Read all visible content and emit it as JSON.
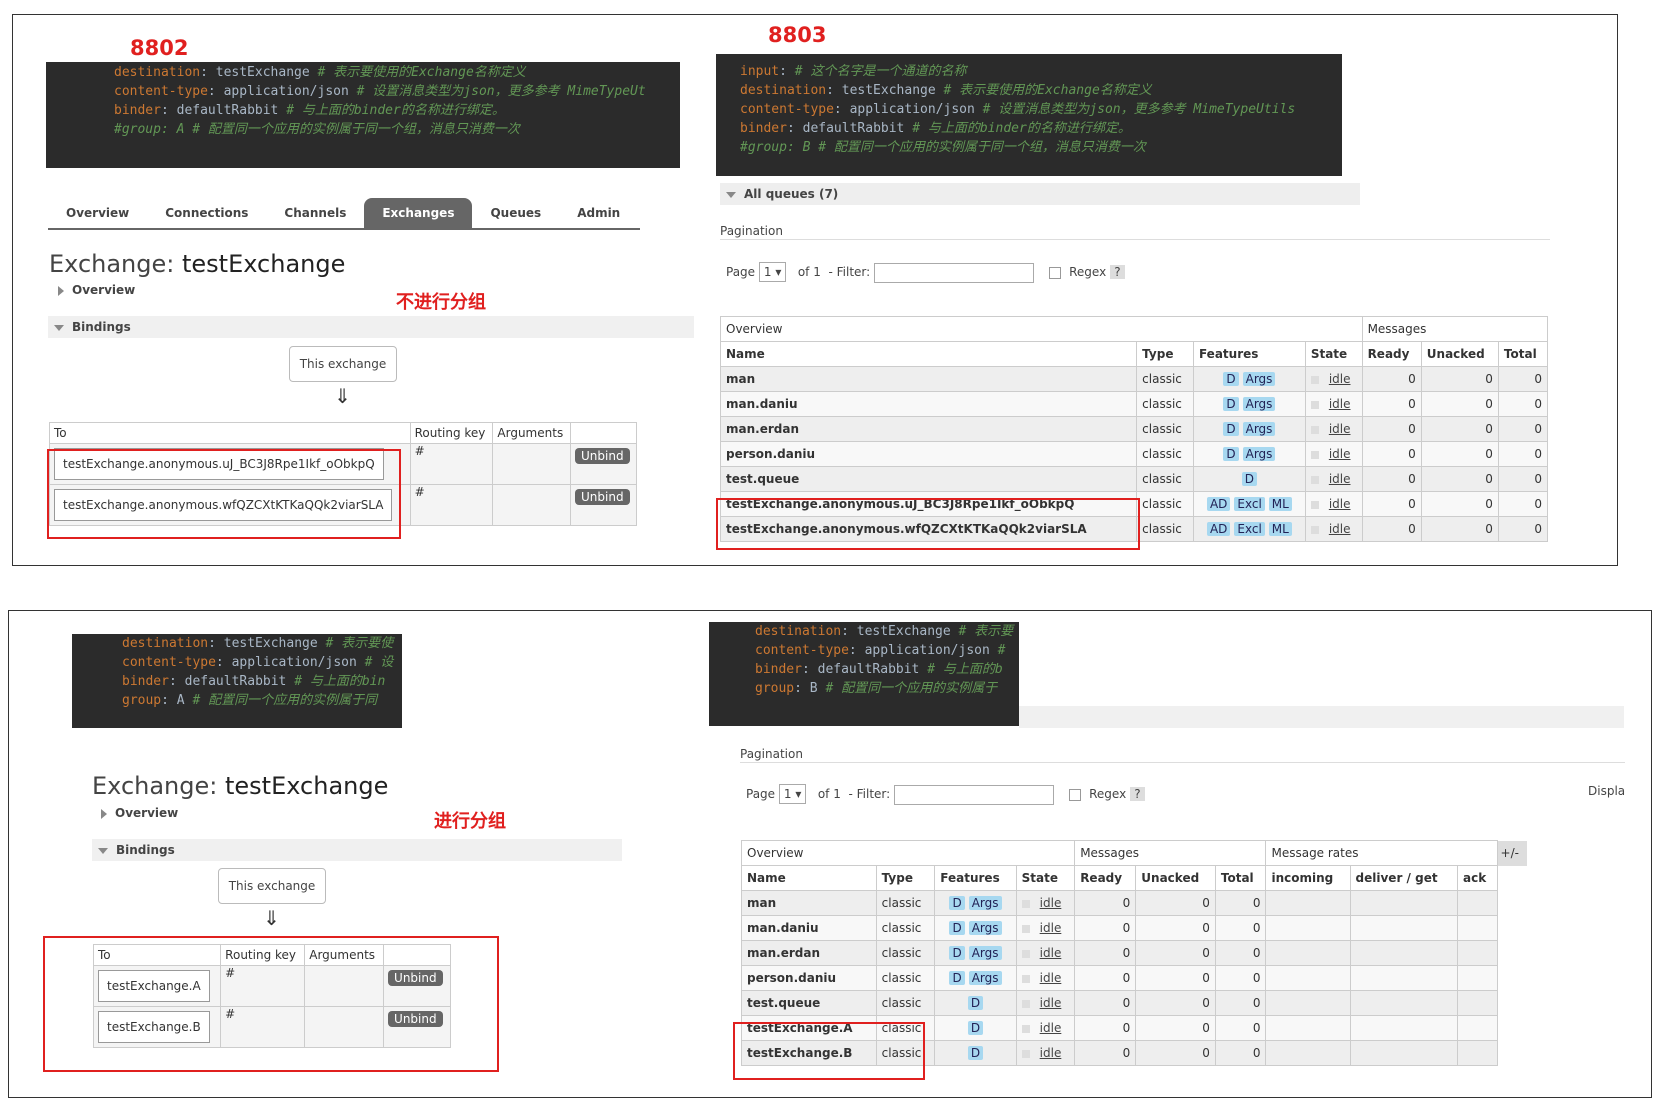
{
  "top": {
    "left_label": "8802",
    "right_label": "8803",
    "left_code": [
      {
        "key": "destination",
        "value": "testExchange",
        "comment": "# 表示要使用的Exchange名称定义"
      },
      {
        "key": "content-type",
        "value": "application/json",
        "comment": "# 设置消息类型为json，更多参考 MimeTypeUt"
      },
      {
        "key": "binder",
        "value": "defaultRabbit",
        "comment": "# 与上面的binder的名称进行绑定。"
      },
      {
        "key": "",
        "value": "",
        "comment": "#group: A # 配置同一个应用的实例属于同一个组，消息只消费一次"
      }
    ],
    "right_code": [
      {
        "key": "input",
        "value": "",
        "comment": "# 这个名字是一个通道的名称"
      },
      {
        "key": "destination",
        "value": "testExchange",
        "comment": "# 表示要使用的Exchange名称定义"
      },
      {
        "key": "content-type",
        "value": "application/json",
        "comment": "# 设置消息类型为json，更多参考 MimeTypeUtils"
      },
      {
        "key": "binder",
        "value": "defaultRabbit",
        "comment": "# 与上面的binder的名称进行绑定。"
      },
      {
        "key": "",
        "value": "",
        "comment": "#group: B # 配置同一个应用的实例属于同一个组，消息只消费一次"
      }
    ],
    "tabs": [
      "Overview",
      "Connections",
      "Channels",
      "Exchanges",
      "Queues",
      "Admin"
    ],
    "exchange_prefix": "Exchange:",
    "exchange_name": "testExchange",
    "overview_label": "Overview",
    "bindings_label": "Bindings",
    "annotation": "不进行分组",
    "this_exchange": "This exchange",
    "arrow": "⇓",
    "bind_headers": [
      "To",
      "Routing key",
      "Arguments"
    ],
    "bindings": [
      {
        "to": "testExchange.anonymous.uJ_BC3J8Rpe1Ikf_oObkpQ",
        "key": "#",
        "unbind": "Unbind"
      },
      {
        "to": "testExchange.anonymous.wfQZCXtKTKaQQk2viarSLA",
        "key": "#",
        "unbind": "Unbind"
      }
    ],
    "all_queues": "All queues (7)",
    "pagination": "Pagination",
    "page_label": "Page",
    "page_value": "1",
    "of_label": "of 1",
    "filter_label": "- Filter:",
    "regex_label": "Regex",
    "help": "?",
    "groups": {
      "overview": "Overview",
      "messages": "Messages"
    },
    "cols": [
      "Name",
      "Type",
      "Features",
      "State",
      "Ready",
      "Unacked",
      "Total"
    ],
    "queues": [
      {
        "name": "man",
        "type": "classic",
        "features": [
          "D",
          "Args"
        ],
        "state": "idle",
        "ready": "0",
        "unacked": "0",
        "total": "0"
      },
      {
        "name": "man.daniu",
        "type": "classic",
        "features": [
          "D",
          "Args"
        ],
        "state": "idle",
        "ready": "0",
        "unacked": "0",
        "total": "0"
      },
      {
        "name": "man.erdan",
        "type": "classic",
        "features": [
          "D",
          "Args"
        ],
        "state": "idle",
        "ready": "0",
        "unacked": "0",
        "total": "0"
      },
      {
        "name": "person.daniu",
        "type": "classic",
        "features": [
          "D",
          "Args"
        ],
        "state": "idle",
        "ready": "0",
        "unacked": "0",
        "total": "0"
      },
      {
        "name": "test.queue",
        "type": "classic",
        "features": [
          "D"
        ],
        "state": "idle",
        "ready": "0",
        "unacked": "0",
        "total": "0"
      },
      {
        "name": "testExchange.anonymous.uJ_BC3J8Rpe1Ikf_oObkpQ",
        "type": "classic",
        "features": [
          "AD",
          "Excl",
          "ML"
        ],
        "state": "idle",
        "ready": "0",
        "unacked": "0",
        "total": "0"
      },
      {
        "name": "testExchange.anonymous.wfQZCXtKTKaQQk2viarSLA",
        "type": "classic",
        "features": [
          "AD",
          "Excl",
          "ML"
        ],
        "state": "idle",
        "ready": "0",
        "unacked": "0",
        "total": "0"
      }
    ]
  },
  "bottom": {
    "left_code": [
      {
        "key": "destination",
        "value": "testExchange",
        "comment": "# 表示要使"
      },
      {
        "key": "content-type",
        "value": "application/json",
        "comment": "# 设"
      },
      {
        "key": "binder",
        "value": "defaultRabbit",
        "comment": "# 与上面的bin"
      },
      {
        "key": "group",
        "value": "A",
        "comment": "# 配置同一个应用的实例属于同"
      }
    ],
    "right_code": [
      {
        "key": "destination",
        "value": "testExchange",
        "comment": "# 表示要"
      },
      {
        "key": "content-type",
        "value": "application/json",
        "comment": "#"
      },
      {
        "key": "binder",
        "value": "defaultRabbit",
        "comment": "# 与上面的b"
      },
      {
        "key": "group",
        "value": "B",
        "comment": "# 配置同一个应用的实例属于"
      }
    ],
    "exchange_prefix": "Exchange:",
    "exchange_name": "testExchange",
    "overview_label": "Overview",
    "bindings_label": "Bindings",
    "annotation": "进行分组",
    "this_exchange": "This exchange",
    "arrow": "⇓",
    "bind_headers": [
      "To",
      "Routing key",
      "Arguments"
    ],
    "bindings": [
      {
        "to": "testExchange.A",
        "key": "#",
        "unbind": "Unbind"
      },
      {
        "to": "testExchange.B",
        "key": "#",
        "unbind": "Unbind"
      }
    ],
    "pagination": "Pagination",
    "page_label": "Page",
    "page_value": "1",
    "of_label": "of 1",
    "filter_label": "- Filter:",
    "regex_label": "Regex",
    "help": "?",
    "display_label": "Displa",
    "groups": {
      "overview": "Overview",
      "messages": "Messages",
      "rates": "Message rates",
      "plusminus": "+/-"
    },
    "cols": [
      "Name",
      "Type",
      "Features",
      "State",
      "Ready",
      "Unacked",
      "Total",
      "incoming",
      "deliver / get",
      "ack"
    ],
    "queues": [
      {
        "name": "man",
        "type": "classic",
        "features": [
          "D",
          "Args"
        ],
        "state": "idle",
        "ready": "0",
        "unacked": "0",
        "total": "0"
      },
      {
        "name": "man.daniu",
        "type": "classic",
        "features": [
          "D",
          "Args"
        ],
        "state": "idle",
        "ready": "0",
        "unacked": "0",
        "total": "0"
      },
      {
        "name": "man.erdan",
        "type": "classic",
        "features": [
          "D",
          "Args"
        ],
        "state": "idle",
        "ready": "0",
        "unacked": "0",
        "total": "0"
      },
      {
        "name": "person.daniu",
        "type": "classic",
        "features": [
          "D",
          "Args"
        ],
        "state": "idle",
        "ready": "0",
        "unacked": "0",
        "total": "0"
      },
      {
        "name": "test.queue",
        "type": "classic",
        "features": [
          "D"
        ],
        "state": "idle",
        "ready": "0",
        "unacked": "0",
        "total": "0"
      },
      {
        "name": "testExchange.A",
        "type": "classic",
        "features": [
          "D"
        ],
        "state": "idle",
        "ready": "0",
        "unacked": "0",
        "total": "0"
      },
      {
        "name": "testExchange.B",
        "type": "classic",
        "features": [
          "D"
        ],
        "state": "idle",
        "ready": "0",
        "unacked": "0",
        "total": "0"
      }
    ]
  }
}
